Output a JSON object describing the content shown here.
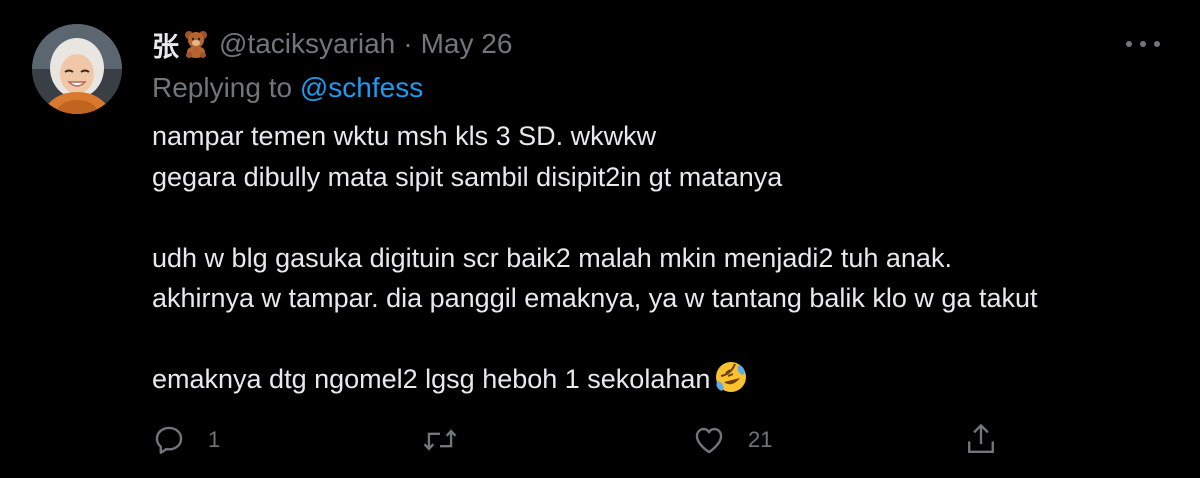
{
  "tweet": {
    "display_name": "张",
    "name_emoji": "teddy-bear",
    "handle": "@taciksyariah",
    "separator": "·",
    "date": "May 26",
    "replying_prefix": "Replying to",
    "replying_handle": "@schfess",
    "lines": [
      "nampar temen wktu msh kls 3 SD. wkwkw",
      "gegara dibully mata sipit sambil disipit2in gt matanya",
      "",
      "udh w blg gasuka digituin scr baik2 malah mkin menjadi2 tuh anak.",
      "akhirnya w tampar. dia panggil emaknya, ya w tantang balik klo w ga takut",
      "",
      "emaknya dtg ngomel2 lgsg heboh 1 sekolahan"
    ],
    "trailing_emoji": "rolling-on-floor-laughing",
    "actions": {
      "reply_count": "1",
      "retweet_count": "",
      "like_count": "21"
    }
  },
  "colors": {
    "background": "#000000",
    "text": "#e7e9ea",
    "muted": "#71767b",
    "link": "#1d9bf0"
  }
}
